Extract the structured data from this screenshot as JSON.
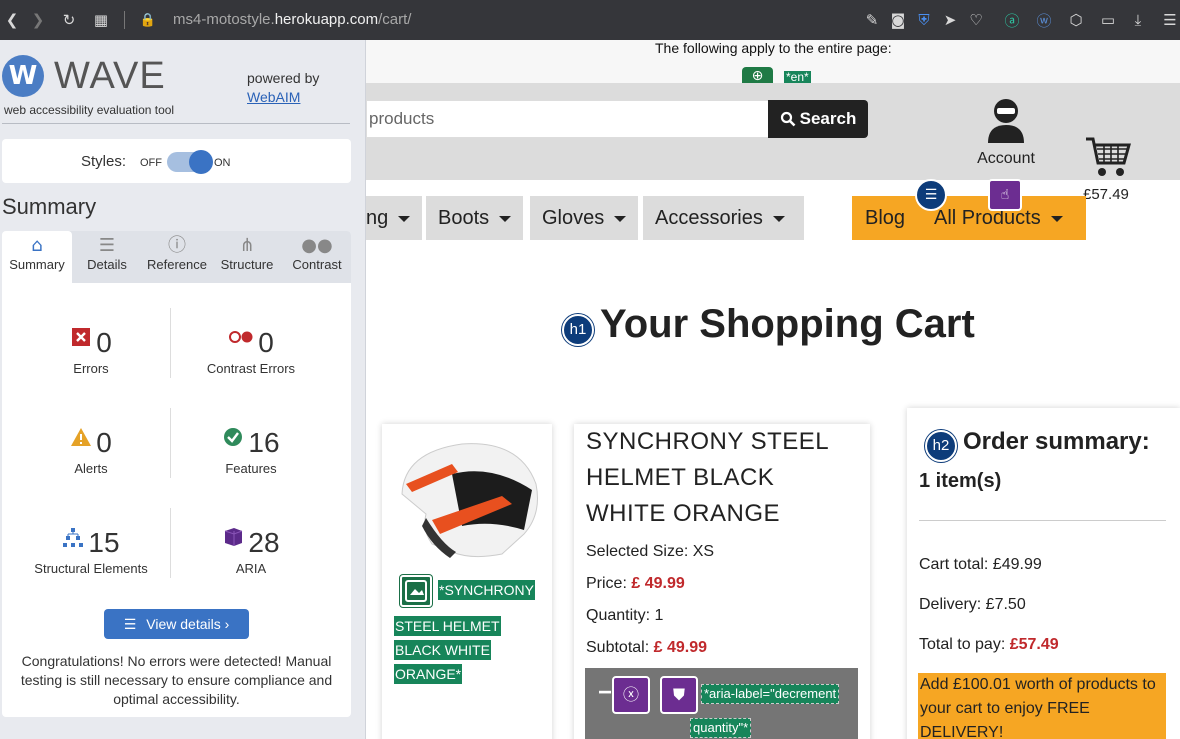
{
  "browser": {
    "url_host_prefix": "ms4-motostyle.",
    "url_host": "herokuapp.com",
    "url_path": "/cart/"
  },
  "page": {
    "top_note": "The following apply to the entire page:",
    "lang_badge": "*en*",
    "search_placeholder": "products",
    "search_button": "Search",
    "account_label": "Account",
    "cart_total": "£57.49",
    "nav": [
      "ng",
      "Boots",
      "Gloves",
      "Accessories",
      "Blog",
      "All Products"
    ],
    "heading_badge": "h1",
    "title": "Your Shopping Cart",
    "product": {
      "alt_text_lines": [
        "*SYNCHRONY",
        "STEEL HELMET",
        "BLACK WHITE",
        "ORANGE*"
      ],
      "name": "SYNCHRONY STEEL HELMET BLACK WHITE ORANGE",
      "size_label": "Selected Size: XS",
      "price_label": "Price:",
      "price_value": "£ 49.99",
      "quantity_label": "Quantity: 1",
      "subtotal_label": "Subtotal:",
      "subtotal_value": "£ 49.99",
      "qty_minus": "−",
      "aria_label_line1": "*aria-label=\"decrement",
      "aria_label_line2": "quantity\"*"
    },
    "order": {
      "badge": "h2",
      "title": "Order summary:",
      "items": "1 item(s)",
      "cart_total": "Cart total: £49.99",
      "delivery": "Delivery: £7.50",
      "total_label": "Total to pay:",
      "total_value": "£57.49",
      "promo": "Add £100.01 worth of products to your cart to enjoy FREE DELIVERY!"
    }
  },
  "wave": {
    "logo_letter": "W",
    "logo_text": "WAVE",
    "tagline": "web accessibility evaluation tool",
    "powered_by": "powered by",
    "webaim": "WebAIM",
    "styles_label": "Styles:",
    "styles_off": "OFF",
    "styles_on": "ON",
    "summary_heading": "Summary",
    "tabs": [
      "Summary",
      "Details",
      "Reference",
      "Structure",
      "Contrast"
    ],
    "stats": {
      "errors": {
        "value": "0",
        "label": "Errors"
      },
      "contrast": {
        "value": "0",
        "label": "Contrast Errors"
      },
      "alerts": {
        "value": "0",
        "label": "Alerts"
      },
      "features": {
        "value": "16",
        "label": "Features"
      },
      "structural": {
        "value": "15",
        "label": "Structural Elements"
      },
      "aria": {
        "value": "28",
        "label": "ARIA"
      }
    },
    "view_details": "View details ›",
    "congrats": "Congratulations! No errors were detected! Manual testing is still necessary to ensure compliance and optimal accessibility."
  },
  "colors": {
    "accent_orange": "#f6a623",
    "wave_blue": "#3a73c4",
    "price_red": "#c0292c",
    "alt_green": "#17855a",
    "aria_purple": "#6c2d91"
  }
}
